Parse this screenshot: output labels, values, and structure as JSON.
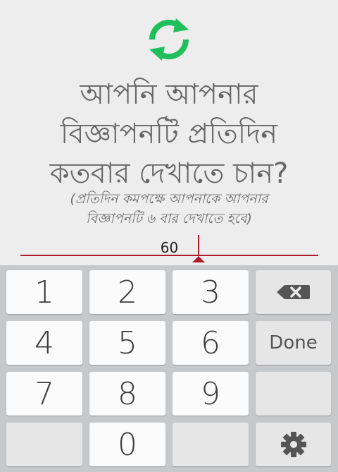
{
  "question": {
    "line1": "আপনি আপনার",
    "line2": "বিজ্ঞাপনটি প্রতিদিন",
    "line3": "কতবার দেখাতে চান?"
  },
  "hint": {
    "line1": "(প্রতিদিন কমপক্ষে আপনাকে আপনার",
    "line2": "বিজ্ঞাপনটি ৬ বার দেখাতে হবে)"
  },
  "input": {
    "value": "60"
  },
  "keyboard": {
    "keys": [
      "1",
      "2",
      "3",
      "4",
      "5",
      "6",
      "7",
      "8",
      "9",
      "0"
    ],
    "done_label": "Done",
    "backspace_icon": "backspace-icon",
    "settings_icon": "gear-icon"
  },
  "colors": {
    "accent": "#b01c2b",
    "refresh": "#1fbf5b",
    "text": "#666666"
  },
  "icons": {
    "top": "refresh-icon"
  }
}
